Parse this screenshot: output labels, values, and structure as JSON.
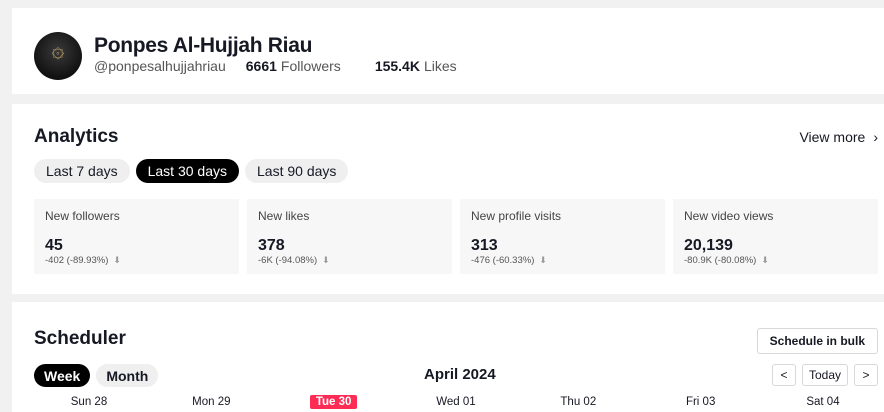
{
  "profile": {
    "name": "Ponpes Al-Hujjah Riau",
    "handle": "@ponpesalhujjahriau",
    "followers_count": "6661",
    "followers_label": "Followers",
    "likes_count": "155.4K",
    "likes_label": "Likes",
    "avatar_icon": "mosque-logo-icon"
  },
  "analytics": {
    "title": "Analytics",
    "view_more": "View more",
    "ranges": [
      {
        "label": "Last 7 days",
        "active": false
      },
      {
        "label": "Last 30 days",
        "active": true
      },
      {
        "label": "Last 90 days",
        "active": false
      }
    ],
    "metrics": [
      {
        "label": "New followers",
        "value": "45",
        "delta": "-402 (-89.93%)"
      },
      {
        "label": "New likes",
        "value": "378",
        "delta": "-6K (-94.08%)"
      },
      {
        "label": "New profile visits",
        "value": "313",
        "delta": "-476 (-60.33%)"
      },
      {
        "label": "New video views",
        "value": "20,139",
        "delta": "-80.9K (-80.08%)"
      }
    ]
  },
  "scheduler": {
    "title": "Scheduler",
    "bulk_button": "Schedule in bulk",
    "views": [
      {
        "label": "Week",
        "active": true
      },
      {
        "label": "Month",
        "active": false
      }
    ],
    "month_title": "April 2024",
    "prev": "<",
    "today": "Today",
    "next": ">",
    "days": [
      {
        "label": "Sun 28",
        "today": false
      },
      {
        "label": "Mon 29",
        "today": false
      },
      {
        "label": "Tue 30",
        "today": true
      },
      {
        "label": "Wed 01",
        "today": false
      },
      {
        "label": "Thu 02",
        "today": false
      },
      {
        "label": "Fri 03",
        "today": false
      },
      {
        "label": "Sat 04",
        "today": false
      }
    ]
  },
  "colors": {
    "accent": "#fe2c55",
    "active_pill": "#000000",
    "background": "#f1f1f2"
  }
}
